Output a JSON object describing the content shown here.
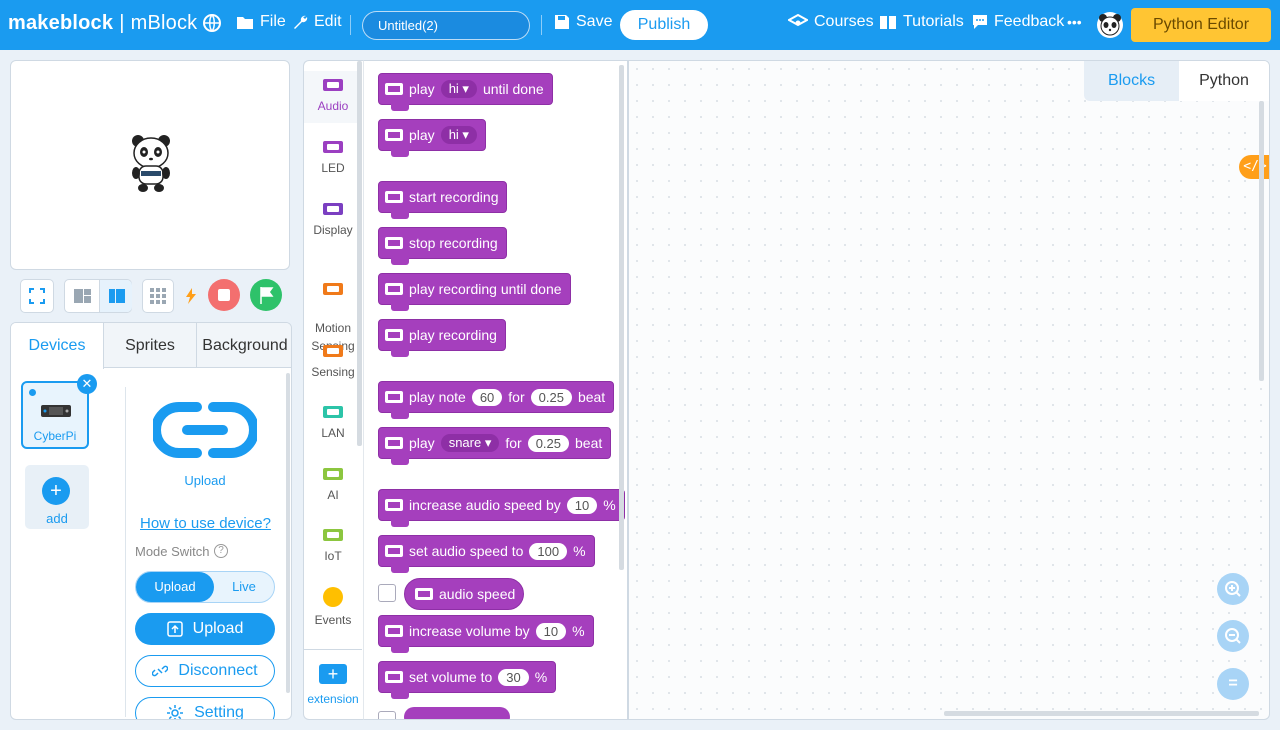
{
  "topbar": {
    "brand": "makeblock",
    "product": "mBlock",
    "menu_file": "File",
    "menu_edit": "Edit",
    "project_title": "Untitled(2)",
    "save": "Save",
    "publish": "Publish",
    "courses": "Courses",
    "tutorials": "Tutorials",
    "feedback": "Feedback",
    "more": "•••",
    "python_editor": "Python Editor",
    "colors": {
      "bar": "#1a9bf0",
      "python_editor": "#ffc533"
    }
  },
  "stage": {
    "sprite_icon": "panda-sprite"
  },
  "devices_panel": {
    "tabs": [
      "Devices",
      "Sprites",
      "Background"
    ],
    "active_tab": "Devices",
    "device_name": "CyberPi",
    "add_label": "add",
    "upload_caption": "Upload",
    "howto_link": "How to use device?",
    "mode_switch_label": "Mode Switch",
    "mode_help": "?",
    "mode_upload": "Upload",
    "mode_live": "Live",
    "upload_button": "Upload",
    "disconnect_button": "Disconnect",
    "setting_button": "Setting"
  },
  "categories": {
    "items": [
      {
        "label": "Audio",
        "color": "#9b3fc1"
      },
      {
        "label": "LED",
        "color": "#9b3fc1"
      },
      {
        "label": "Display",
        "color": "#7b3fc1"
      },
      {
        "label": "Motion\nSensing",
        "color": "#f07a1a"
      },
      {
        "label": "Sensing",
        "color": "#f07a1a"
      },
      {
        "label": "LAN",
        "color": "#2cc4a8"
      },
      {
        "label": "AI",
        "color": "#8cc63f"
      },
      {
        "label": "IoT",
        "color": "#8cc63f"
      },
      {
        "label": "Events",
        "color": "#ffbf00"
      }
    ],
    "extension": "extension"
  },
  "blocks": {
    "b1": {
      "pre": "play",
      "dd": "hi ▾",
      "post": "until done"
    },
    "b2": {
      "pre": "play",
      "dd": "hi ▾"
    },
    "b3": "start recording",
    "b4": "stop recording",
    "b5": "play recording until done",
    "b6": "play recording",
    "b7": {
      "pre": "play note",
      "v1": "60",
      "mid": "for",
      "v2": "0.25",
      "post": "beat"
    },
    "b8": {
      "pre": "play",
      "dd": "snare ▾",
      "mid": "for",
      "v2": "0.25",
      "post": "beat"
    },
    "b9": {
      "pre": "increase audio speed by",
      "v1": "10",
      "post": "%"
    },
    "b10": {
      "pre": "set audio speed to",
      "v1": "100",
      "post": "%"
    },
    "b11": "audio speed",
    "b12": {
      "pre": "increase volume by",
      "v1": "10",
      "post": "%"
    },
    "b13": {
      "pre": "set volume to",
      "v1": "30",
      "post": "%"
    }
  },
  "workspace": {
    "tab_blocks": "Blocks",
    "tab_python": "Python",
    "code_toggle": "</>",
    "zoom_in": "+",
    "zoom_out": "−",
    "zoom_reset": "="
  }
}
